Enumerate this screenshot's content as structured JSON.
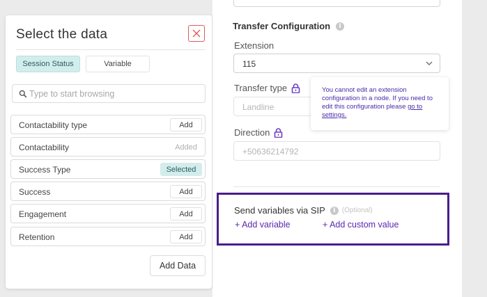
{
  "modal": {
    "title": "Select the data",
    "tabs": [
      "Session Status",
      "Variable"
    ],
    "search_placeholder": "Type to start browsing",
    "rows": [
      {
        "name": "Contactability type",
        "action": "Add"
      },
      {
        "name": "Contactability",
        "action": "Added"
      },
      {
        "name": "Success Type",
        "action": "Selected"
      },
      {
        "name": "Success",
        "action": "Add"
      },
      {
        "name": "Engagement",
        "action": "Add"
      },
      {
        "name": "Retention",
        "action": "Add"
      }
    ],
    "add_data_label": "Add Data"
  },
  "config": {
    "section_title": "Transfer Configuration",
    "extension_label": "Extension",
    "extension_value": "115",
    "transfer_type_label": "Transfer type",
    "transfer_type_value": "Landline",
    "direction_label": "Direction",
    "direction_value": "+50636214792",
    "tooltip_text": "You cannot edit an extension configuration in a node. If you need to edit this configuration please ",
    "tooltip_link": "go to settings.",
    "sip_title": "Send variables via SIP",
    "sip_optional": "(Optional)",
    "add_variable_label": "+ Add variable",
    "add_custom_value_label": "+ Add custom value"
  },
  "colors": {
    "accent_purple": "#5a27b0",
    "highlight_border": "#4a1c8c",
    "teal_tab": "#d3ecec",
    "close_red": "#e05a5a"
  }
}
